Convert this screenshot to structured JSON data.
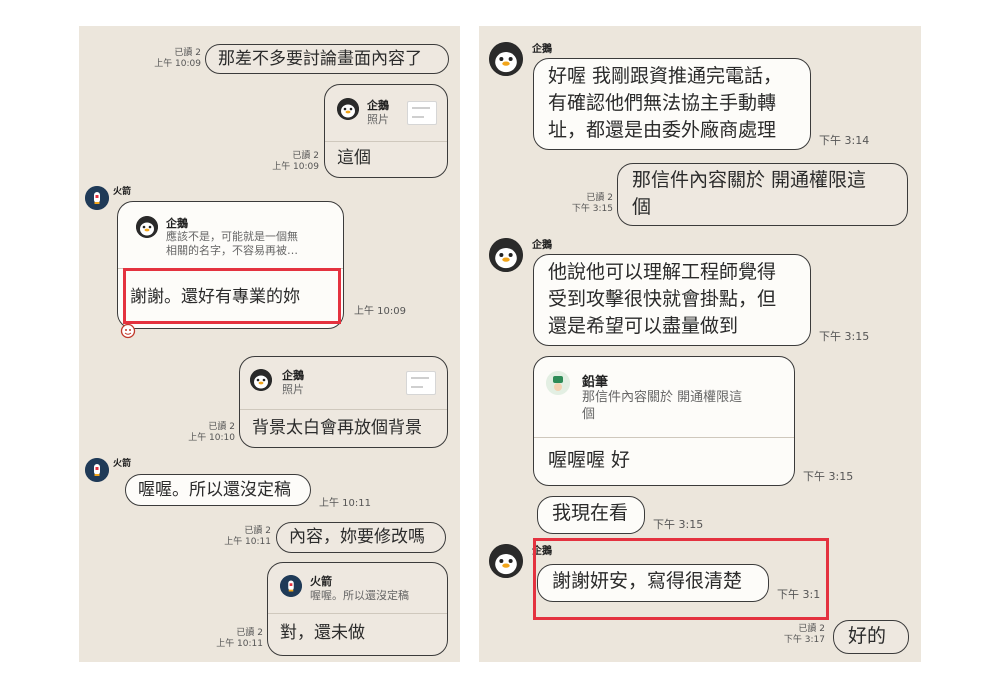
{
  "left": {
    "m1": {
      "read": "已讀 2",
      "time": "上午 10:09",
      "text": "那差不多要討論畫面內容了"
    },
    "m2": {
      "quote_name": "企鵝",
      "quote_text": "照片",
      "read": "已讀 2",
      "time": "上午 10:09",
      "text": "這個"
    },
    "m3": {
      "sender": "火箭",
      "quote_name": "企鵝",
      "quote_text": "應該不是，可能就是一個無\n相關的名字，不容易再被…",
      "text": "謝謝。還好有專業的妳",
      "time": "上午 10:09"
    },
    "m4": {
      "quote_name": "企鵝",
      "quote_text": "照片",
      "read": "已讀 2",
      "time": "上午 10:10",
      "text": "背景太白會再放個背景"
    },
    "m5": {
      "sender": "火箭",
      "text": "喔喔。所以還沒定稿",
      "time": "上午 10:11"
    },
    "m6": {
      "read": "已讀 2",
      "time": "上午 10:11",
      "text": "內容，妳要修改嗎"
    },
    "m7": {
      "quote_name": "火箭",
      "quote_text": "喔喔。所以還沒定稿",
      "read": "已讀 2",
      "time": "上午 10:11",
      "text": "對，還未做"
    }
  },
  "right": {
    "m1": {
      "sender": "企鵝",
      "text": "好喔  我剛跟資推通完電話，\n有確認他們無法協主手動轉\n址，都還是由委外廠商處理",
      "time": "下午 3:14"
    },
    "m2": {
      "read": "已讀 2",
      "time": "下午 3:15",
      "text": "那信件內容關於  開通權限這\n個"
    },
    "m3": {
      "sender": "企鵝",
      "text": "他說他可以理解工程師覺得\n受到攻擊很快就會掛點，但\n還是希望可以盡量做到",
      "time": "下午 3:15"
    },
    "m4": {
      "quote_name": "鉛筆",
      "quote_text": "那信件內容關於 開通權限這\n個",
      "text": "喔喔喔 好",
      "time": "下午 3:15"
    },
    "m5": {
      "text": "我現在看",
      "time": "下午 3:15"
    },
    "m6": {
      "sender": "企鵝",
      "text": "謝謝妍安，寫得很清楚",
      "time": "下午 3:1"
    },
    "m7": {
      "read": "已讀 2",
      "time": "下午 3:17",
      "text": "好的"
    }
  },
  "colors": {
    "panel_bg": "#ece6dc",
    "bubble_in": "#fdfcf9",
    "bubble_out": "#eee8e0",
    "highlight": "#e4323f",
    "avatar_penguin": "#2a2a2a",
    "avatar_rocket": "#1f3a57",
    "avatar_pencil": "#2e8b57"
  },
  "icons": {
    "penguin": "penguin-icon",
    "rocket": "rocket-icon",
    "pencil": "pencil-icon",
    "reaction": "reaction-icon"
  }
}
